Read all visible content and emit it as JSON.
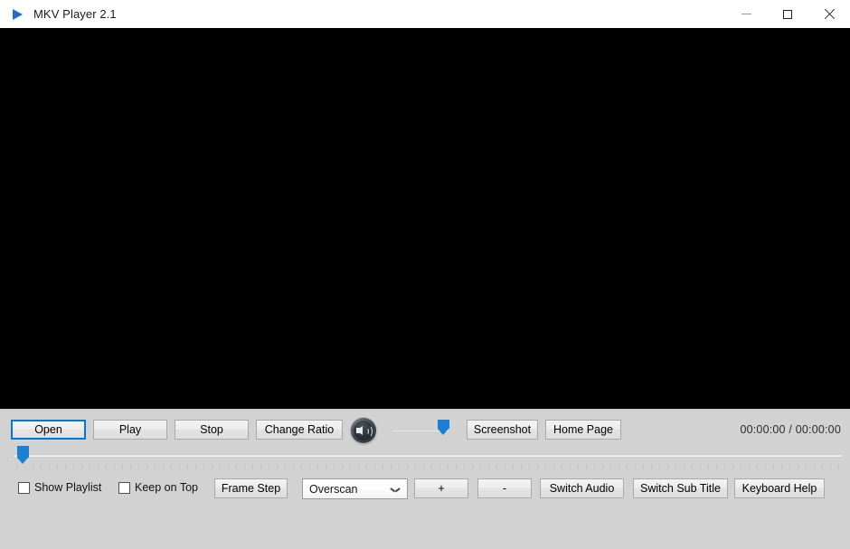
{
  "window": {
    "title": "MKV Player 2.1",
    "icon": "play-triangle-icon",
    "controls": {
      "minimize": "minimize",
      "maximize": "maximize",
      "close": "close"
    }
  },
  "video": {
    "background_color": "#000000",
    "content": ""
  },
  "controls": {
    "open_label": "Open",
    "play_label": "Play",
    "stop_label": "Stop",
    "change_ratio_label": "Change Ratio",
    "volume_icon": "speaker-volume-icon",
    "screenshot_label": "Screenshot",
    "home_page_label": "Home Page",
    "time_display": "00:00:00 / 00:00:00",
    "seek": {
      "value": 0,
      "min": 0,
      "max": 100
    },
    "volume": {
      "value": 100,
      "min": 0,
      "max": 100
    }
  },
  "options": {
    "show_playlist_label": "Show Playlist",
    "show_playlist_checked": false,
    "keep_on_top_label": "Keep on Top",
    "keep_on_top_checked": false,
    "frame_step_label": "Frame Step",
    "ratio_mode_selected": "Overscan",
    "ratio_mode_options": [
      "Overscan"
    ],
    "plus_label": "+",
    "minus_label": "-",
    "switch_audio_label": "Switch Audio",
    "switch_subtitle_label": "Switch Sub Title",
    "keyboard_help_label": "Keyboard Help"
  },
  "colors": {
    "accent": "#1b7fd4",
    "focus_border": "#0078d7",
    "panel": "#d2d2d2",
    "titlebar": "#ffffff",
    "video": "#000000"
  }
}
